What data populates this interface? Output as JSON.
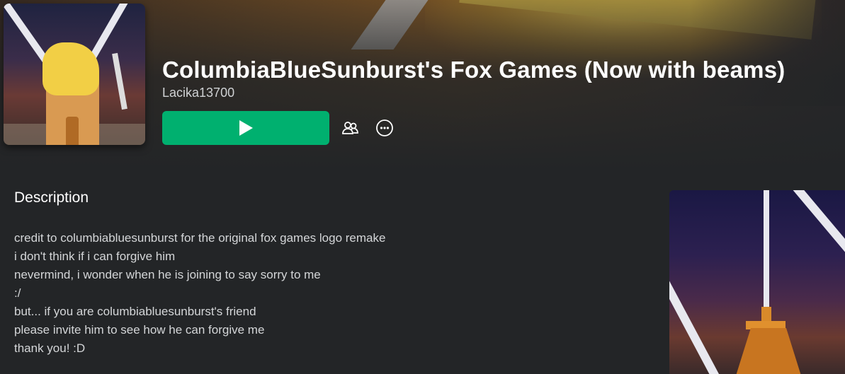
{
  "game": {
    "title": "ColumbiaBlueSunburst's Fox Games (Now with beams)",
    "creator": "Lacika13700"
  },
  "actions": {
    "play_icon": "play-icon",
    "friends_icon": "friends-icon",
    "more_icon": "more-options-icon",
    "play_color": "#00b06f"
  },
  "description": {
    "heading": "Description",
    "lines": [
      "credit to columbiabluesunburst for the original fox games logo remake",
      "i don't think if i can forgive him",
      "nevermind, i wonder when he is joining to say sorry to me",
      ":/",
      "but... if you are columbiabluesunburst's friend",
      "please invite him to see how he can forgive me",
      "thank you! :D"
    ]
  }
}
